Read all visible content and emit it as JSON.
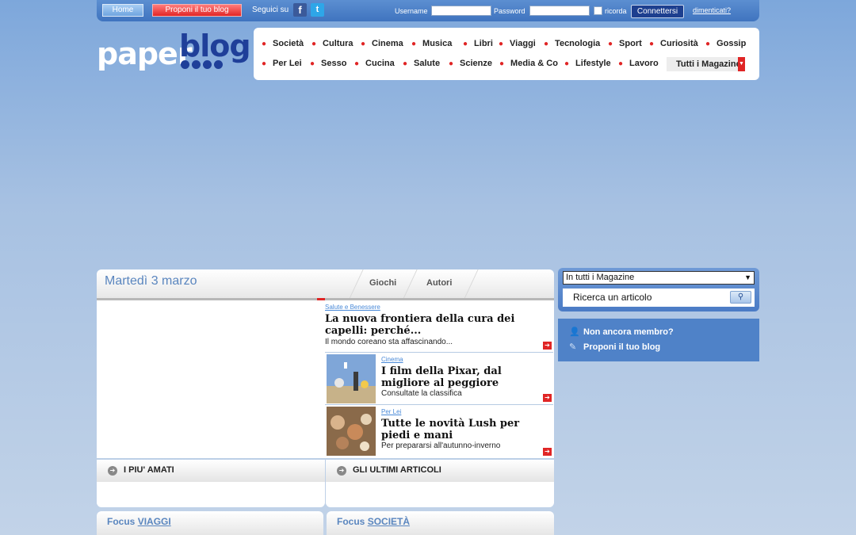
{
  "topbar": {
    "home_label": "Home",
    "propose_label": "Proponi il tuo blog",
    "follow_label": "Seguici su",
    "facebook_glyph": "f",
    "twitter_glyph": "t",
    "username_label": "Username",
    "password_label": "Password",
    "remember_label": "ricorda",
    "connect_label": "Connettersi",
    "forgot_label": "dimenticati?"
  },
  "logo": {
    "part1": "paper",
    "part2": "blog"
  },
  "nav": {
    "row1": [
      "Società",
      "Cultura",
      "Cinema",
      "Musica",
      "Libri",
      "Viaggi",
      "Tecnologia",
      "Sport",
      "Curiosità",
      "Gossip"
    ],
    "row2": [
      "Per Lei",
      "Sesso",
      "Cucina",
      "Salute",
      "Scienze",
      "Media & Co",
      "Lifestyle",
      "Lavoro"
    ],
    "all_label": "Tutti i Magazine"
  },
  "main": {
    "date": "Martedì 3 marzo",
    "tabs": [
      "Giochi",
      "Autori"
    ],
    "articles": [
      {
        "category": "Salute e Benessere",
        "title": "La nuova frontiera della cura dei capelli: perché...",
        "subtitle": "Il mondo coreano sta affascinando..."
      },
      {
        "category": "Cinema",
        "title": "I film della Pixar, dal migliore al peggiore",
        "subtitle": "Consultate la classifica"
      },
      {
        "category": "Per Lei",
        "title": "Tutte le novità Lush per piedi e mani",
        "subtitle": "Per prepararsi all'autunno-inverno"
      }
    ],
    "more_glyph": "➔",
    "lists": [
      "I PIU' AMATI",
      "GLI ULTIMI ARTICOLI"
    ],
    "focus": [
      {
        "prefix": "Focus",
        "topic": "VIAGGI"
      },
      {
        "prefix": "Focus",
        "topic": "SOCIETÀ"
      }
    ]
  },
  "sidebar": {
    "select_value": "In tutti i Magazine",
    "search_placeholder": "Ricerca un articolo",
    "member_items": [
      "Non ancora membro?",
      "Proponi il tuo blog"
    ]
  },
  "colors": {
    "accent_red": "#e02525",
    "brand_blue": "#1f3f99",
    "link_blue": "#5a86bf"
  }
}
